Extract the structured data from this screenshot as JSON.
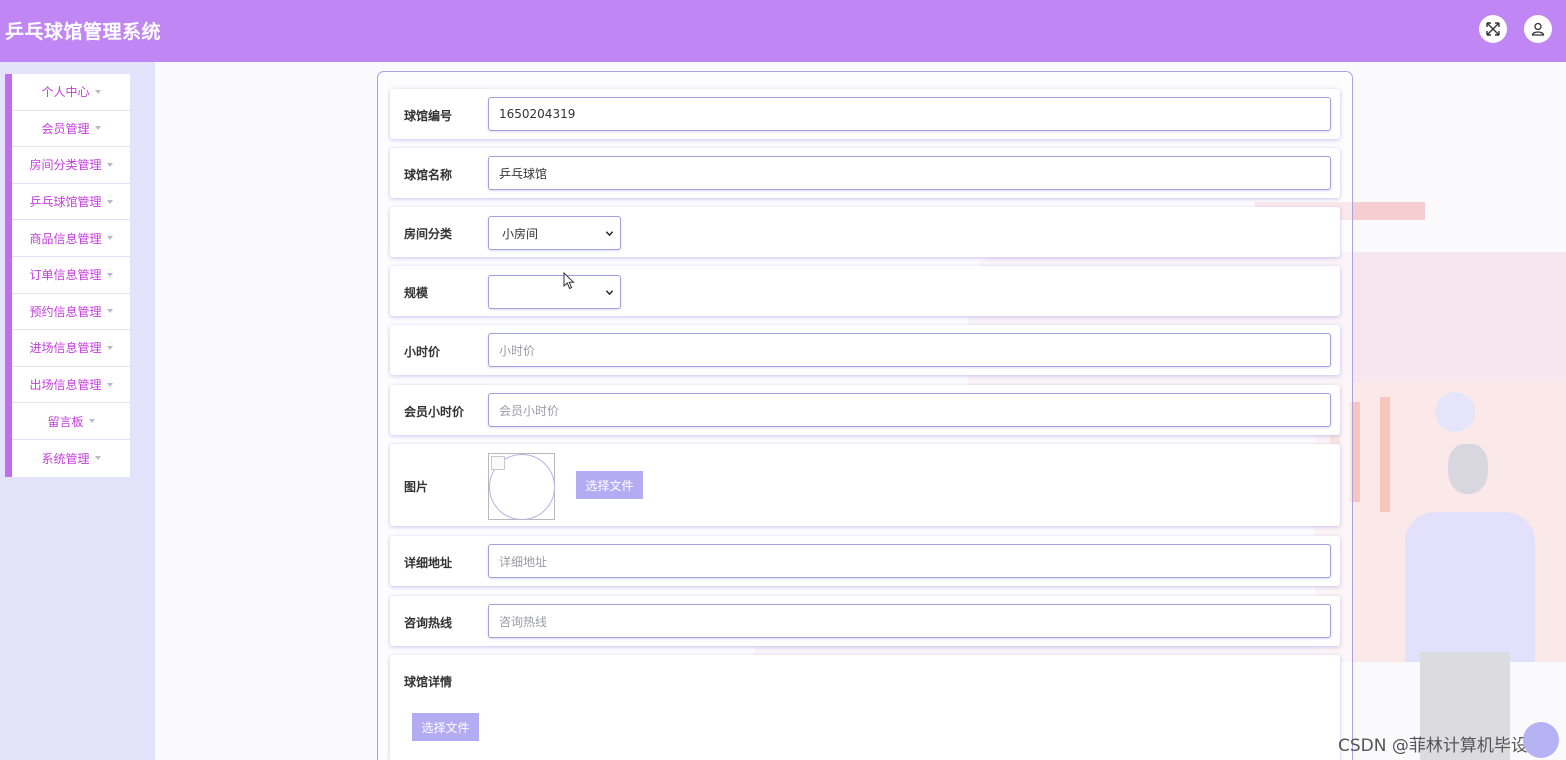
{
  "header": {
    "title": "乒乓球馆管理系统",
    "fullscreen_icon": "expand-icon",
    "user_icon": "user-icon"
  },
  "sidebar": {
    "items": [
      {
        "label": "个人中心"
      },
      {
        "label": "会员管理"
      },
      {
        "label": "房间分类管理"
      },
      {
        "label": "乒乓球馆管理"
      },
      {
        "label": "商品信息管理"
      },
      {
        "label": "订单信息管理"
      },
      {
        "label": "预约信息管理"
      },
      {
        "label": "进场信息管理"
      },
      {
        "label": "出场信息管理"
      },
      {
        "label": "留言板"
      },
      {
        "label": "系统管理"
      }
    ]
  },
  "form": {
    "hall_no": {
      "label": "球馆编号",
      "value": "1650204319"
    },
    "hall_name": {
      "label": "球馆名称",
      "value": "乒乓球馆"
    },
    "room_category": {
      "label": "房间分类",
      "value": "小房间"
    },
    "scale": {
      "label": "规模",
      "value": ""
    },
    "hourly_price": {
      "label": "小时价",
      "placeholder": "小时价"
    },
    "member_hourly_price": {
      "label": "会员小时价",
      "placeholder": "会员小时价"
    },
    "picture": {
      "label": "图片",
      "button": "选择文件"
    },
    "address": {
      "label": "详细地址",
      "placeholder": "详细地址"
    },
    "hotline": {
      "label": "咨询热线",
      "placeholder": "咨询热线"
    },
    "details": {
      "label": "球馆详情",
      "button": "选择文件"
    }
  },
  "watermark": "CSDN @菲林计算机毕设",
  "colors": {
    "header": "#c087f4",
    "sidebar_accent": "#c26cf0",
    "menu_text": "#c241d9",
    "upload_button": "#b3acf3"
  }
}
